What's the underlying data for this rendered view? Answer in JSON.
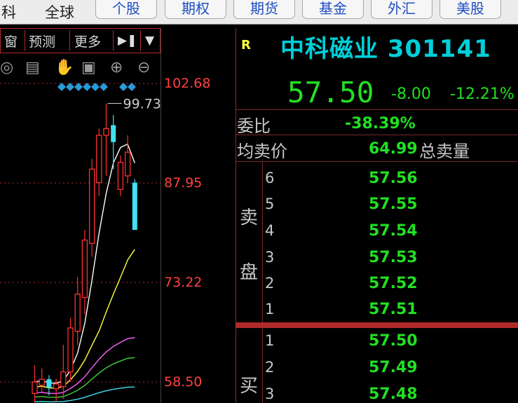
{
  "topbar": {
    "left_cut": "科",
    "global": "全球",
    "tabs": [
      "个股",
      "期权",
      "期货",
      "基金",
      "外汇",
      "美股"
    ]
  },
  "toolbar": {
    "items": [
      "窗",
      "预测",
      "更多"
    ],
    "play_icon": "skip-forward-icon",
    "dropdown_icon": "chevron-down-icon"
  },
  "chart_icons": [
    "eye-icon",
    "basket-icon",
    "hand-icon",
    "lock-icon",
    "zoom-in-icon",
    "zoom-out-icon"
  ],
  "chart_data": {
    "type": "candlestick",
    "price_axis_labels": [
      "102.68",
      "87.95",
      "73.22",
      "58.50"
    ],
    "high_annotation": "99.73",
    "colors": {
      "up": "#ff3030",
      "down": "#40e0f0",
      "ma5": "#ffffff",
      "ma10": "#ffff40",
      "ma20": "#ff60ff",
      "ma30": "#40d040",
      "ma60": "#40e0f0"
    },
    "candles": [
      {
        "open": 56.8,
        "close": 58.5,
        "high": 61.0,
        "low": 55.0
      },
      {
        "open": 58.0,
        "close": 58.9,
        "high": 60.5,
        "low": 57.0
      },
      {
        "open": 58.9,
        "close": 57.7,
        "high": 59.5,
        "low": 56.5
      },
      {
        "open": 57.5,
        "close": 58.2,
        "high": 59.0,
        "low": 55.5
      },
      {
        "open": 57.8,
        "close": 60.0,
        "high": 64.0,
        "low": 56.0
      },
      {
        "open": 60.0,
        "close": 66.5,
        "high": 68.0,
        "low": 58.5
      },
      {
        "open": 66.0,
        "close": 71.5,
        "high": 74.0,
        "low": 64.0
      },
      {
        "open": 71.0,
        "close": 79.5,
        "high": 81.0,
        "low": 68.5
      },
      {
        "open": 79.0,
        "close": 90.0,
        "high": 91.5,
        "low": 77.0
      },
      {
        "open": 88.0,
        "close": 95.0,
        "high": 96.0,
        "low": 86.0
      },
      {
        "open": 95.0,
        "close": 96.0,
        "high": 99.7,
        "low": 89.0
      },
      {
        "open": 96.5,
        "close": 94.0,
        "high": 98.0,
        "low": 90.0
      },
      {
        "open": 87.0,
        "close": 91.0,
        "high": 92.0,
        "low": 86.0
      },
      {
        "open": 89.0,
        "close": 92.5,
        "high": 95.0,
        "low": 88.0
      },
      {
        "open": 88.0,
        "close": 81.0,
        "high": 88.5,
        "low": 81.0
      }
    ]
  },
  "quote": {
    "flag": "R",
    "name_code": "中科磁业 301141",
    "price": "57.50",
    "change": "-8.00",
    "change_pct": "-12.21%",
    "weibi_label": "委比",
    "weibi_value": "-38.39%",
    "avg_sell_label": "均卖价",
    "avg_sell_value": "64.99",
    "total_sell_label": "总卖量",
    "sell_side_label": [
      "卖",
      "盘"
    ],
    "buy_side_label": "买",
    "sell_levels": [
      {
        "level": "6",
        "price": "57.56"
      },
      {
        "level": "5",
        "price": "57.55"
      },
      {
        "level": "4",
        "price": "57.54"
      },
      {
        "level": "3",
        "price": "57.53"
      },
      {
        "level": "2",
        "price": "57.52"
      },
      {
        "level": "1",
        "price": "57.51"
      }
    ],
    "buy_levels": [
      {
        "level": "1",
        "price": "57.50"
      },
      {
        "level": "2",
        "price": "57.49"
      },
      {
        "level": "3",
        "price": "57.48"
      }
    ]
  }
}
